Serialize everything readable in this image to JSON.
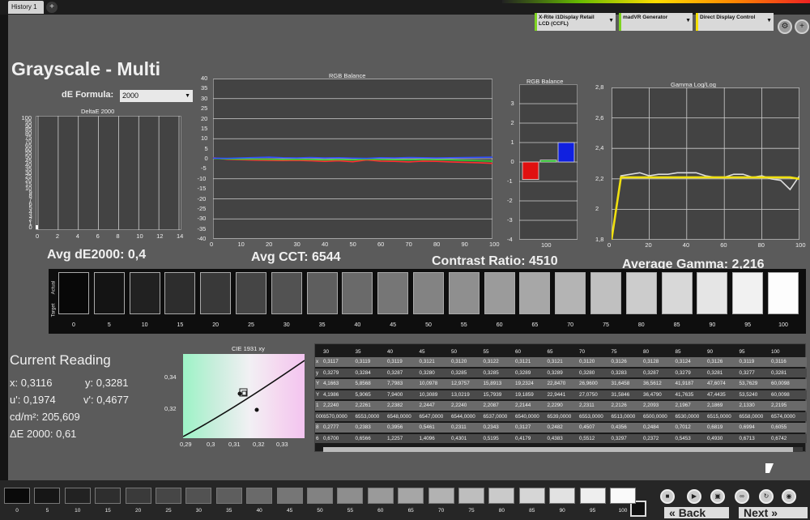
{
  "tabs": [
    {
      "label": "History 1"
    }
  ],
  "add_tab_icon": "plus-icon",
  "devices": {
    "meter": "X-Rite i1Display Retail LCD (CCFL)",
    "generator": "madVR Generator",
    "display": "Direct Display Control"
  },
  "page": {
    "title": "Grayscale - Multi",
    "formula_label": "dE Formula:",
    "formula_value": "2000"
  },
  "charts": {
    "delta_title": "DeltaE 2000",
    "rgb_title": "RGB Balance",
    "rgb_small_title": "RGB Balance",
    "gamma_title": "Gamma Log/Log"
  },
  "stats": {
    "avg_de": "Avg dE2000: 0,4",
    "avg_cct": "Avg CCT: 6544",
    "contrast": "Contrast Ratio: 4510",
    "avg_gamma": "Average Gamma: 2,216"
  },
  "band": {
    "actual_label": "Actual",
    "target_label": "Target"
  },
  "current_reading": {
    "title": "Current Reading",
    "x": "x: 0,3116",
    "y": "y: 0,3281",
    "u": "u': 0,1974",
    "v": "v': 0,4677",
    "cd": "cd/m²: 205,609",
    "de": "ΔE 2000: 0,61"
  },
  "cie": {
    "title": "CIE 1931 xy",
    "xticks": [
      "0,29",
      "0,3",
      "0,31",
      "0,32",
      "0,33"
    ],
    "yticks": [
      "0,34",
      "0,32"
    ]
  },
  "table": {
    "headers": [
      "30",
      "35",
      "40",
      "45",
      "50",
      "55",
      "60",
      "65",
      "70",
      "75",
      "80",
      "85",
      "90",
      "95",
      "100"
    ],
    "rows": [
      {
        "key": "x",
        "values": [
          "0,3117",
          "0,3119",
          "0,3119",
          "0,3121",
          "0,3120",
          "0,3122",
          "0,3121",
          "0,3121",
          "0,3120",
          "0,3126",
          "0,3128",
          "0,3124",
          "0,3126",
          "0,3119",
          "0,3116"
        ]
      },
      {
        "key": "y",
        "values": [
          "0,3279",
          "0,3284",
          "0,3287",
          "0,3280",
          "0,3285",
          "0,3285",
          "0,3289",
          "0,3289",
          "0,3280",
          "0,3283",
          "0,3287",
          "0,3279",
          "0,3281",
          "0,3277",
          "0,3281"
        ]
      },
      {
        "key": "Y",
        "values": [
          "4,1663",
          "5,8568",
          "7,7983",
          "10,0978",
          "12,9757",
          "15,8913",
          "19,2324",
          "22,8470",
          "26,9600",
          "31,6458",
          "36,5612",
          "41,9187",
          "47,6074",
          "53,7629",
          "60,0098"
        ]
      },
      {
        "key": "Y",
        "values": [
          "4,1986",
          "5,9065",
          "7,9400",
          "10,3089",
          "13,0219",
          "15,7939",
          "19,1859",
          "22,9441",
          "27,0750",
          "31,5846",
          "36,4790",
          "41,7635",
          "47,4435",
          "53,5240",
          "60,0098"
        ]
      },
      {
        "key": "1",
        "values": [
          "2,2240",
          "2,2261",
          "2,2382",
          "2,2447",
          "2,2240",
          "2,2087",
          "2,2144",
          "2,2290",
          "2,2311",
          "2,2126",
          "2,2093",
          "2,1967",
          "2,1869",
          "2,1330",
          "2,2195"
        ]
      },
      {
        "key": "0000",
        "values": [
          "6570,0000",
          "6553,0000",
          "6548,0000",
          "6547,0000",
          "6544,0000",
          "6537,0000",
          "6540,0000",
          "6539,0000",
          "6553,0000",
          "6513,0000",
          "6500,0000",
          "6530,0000",
          "6515,0000",
          "6558,0000",
          "6574,0000"
        ]
      },
      {
        "key": "8",
        "values": [
          "0,2777",
          "0,2383",
          "0,3956",
          "0,5461",
          "0,2311",
          "0,2343",
          "0,3127",
          "0,2482",
          "0,4507",
          "0,4356",
          "0,2484",
          "0,7012",
          "0,6819",
          "0,6994",
          "0,6055"
        ]
      },
      {
        "key": "6",
        "values": [
          "0,6700",
          "0,6566",
          "1,2257",
          "1,4096",
          "0,4301",
          "0,5195",
          "0,4179",
          "0,4383",
          "0,5512",
          "0,3297",
          "0,2372",
          "0,5453",
          "0,4930",
          "0,6713",
          "0,6742"
        ]
      }
    ]
  },
  "bottom": {
    "back": "Back",
    "next": "Next"
  },
  "colors": {
    "panel": "#5b5b5b",
    "plot": "#434343",
    "gamma_line": "#f0e010",
    "meter_bar": "#7ed321",
    "generator_bar": "#7ed321",
    "display_bar": "#f5e000"
  },
  "chart_data": [
    {
      "type": "bar",
      "title": "DeltaE 2000",
      "yticks": [
        0,
        1,
        2,
        3,
        4,
        5,
        6,
        7,
        8,
        9,
        10,
        15,
        20,
        25,
        30,
        35,
        40,
        45,
        50,
        55,
        60,
        65,
        70,
        75,
        80,
        85,
        90,
        95,
        100
      ],
      "xticks": [
        0,
        2,
        4,
        6,
        8,
        10,
        12,
        14
      ],
      "values": [
        0.3,
        0.3,
        0.3,
        0.4,
        0.2,
        0.2,
        0.3,
        0.2,
        0.5,
        0.4,
        0.2,
        0.7,
        0.7,
        0.7,
        0.6
      ]
    },
    {
      "type": "line",
      "title": "RGB Balance",
      "x": [
        0,
        5,
        10,
        15,
        20,
        25,
        30,
        35,
        40,
        45,
        50,
        55,
        60,
        65,
        70,
        75,
        80,
        85,
        90,
        95,
        100
      ],
      "xticks": [
        0,
        10,
        20,
        30,
        40,
        50,
        60,
        70,
        80,
        90,
        100
      ],
      "yticks": [
        40,
        35,
        30,
        25,
        20,
        15,
        10,
        5,
        0,
        -5,
        -10,
        -15,
        -20,
        -25,
        -30,
        -35,
        -40
      ],
      "ylim": [
        -40,
        40
      ],
      "series": [
        {
          "color": "#ff3030",
          "values": [
            0.5,
            -0.3,
            -0.5,
            -0.7,
            -0.8,
            -0.9,
            -0.8,
            -1.0,
            -1.3,
            -1.0,
            -1.5,
            -0.6,
            -1.2,
            -1.3,
            -1.6,
            -1.2,
            -1.3,
            -1.6,
            -1.8,
            -2.0,
            -2.3
          ]
        },
        {
          "color": "#30d030",
          "values": [
            0.2,
            -0.1,
            -0.2,
            -0.2,
            -0.3,
            -0.4,
            -0.3,
            -0.4,
            -0.6,
            -0.4,
            -0.6,
            -0.2,
            -0.4,
            -0.5,
            -0.6,
            -0.4,
            -0.5,
            -0.6,
            -0.8,
            -1.0,
            -1.2
          ]
        },
        {
          "color": "#3050ff",
          "values": [
            0.3,
            0.2,
            0.4,
            0.6,
            0.8,
            0.5,
            0.4,
            0.6,
            0.4,
            0.5,
            0.3,
            0.2,
            0.5,
            0.4,
            0.6,
            0.5,
            0.4,
            0.5,
            0.6,
            0.7,
            0.8
          ]
        }
      ]
    },
    {
      "type": "bar",
      "title": "RGB Balance",
      "categories": [
        "100"
      ],
      "yticks": [
        3,
        2,
        1,
        0,
        -1,
        -2,
        -3,
        -4
      ],
      "ylim": [
        -4,
        4
      ],
      "series": [
        {
          "color": "#e01010",
          "values": [
            -0.9
          ]
        },
        {
          "color": "#10c010",
          "values": [
            0.1
          ]
        },
        {
          "color": "#1020e0",
          "values": [
            1.0
          ]
        }
      ]
    },
    {
      "type": "line",
      "title": "Gamma Log/Log",
      "x": [
        0,
        5,
        10,
        15,
        20,
        25,
        30,
        35,
        40,
        45,
        50,
        55,
        60,
        65,
        70,
        75,
        80,
        85,
        90,
        95,
        100
      ],
      "xticks": [
        0,
        20,
        40,
        60,
        80,
        100
      ],
      "yticks": [
        "2,8",
        "2,6",
        "2,4",
        "2,2",
        "2",
        "1,8"
      ],
      "ylim": [
        1.8,
        2.8
      ],
      "series": [
        {
          "color": "#f0e010",
          "values": [
            1.8,
            2.21,
            2.21,
            2.21,
            2.21,
            2.21,
            2.21,
            2.21,
            2.21,
            2.21,
            2.21,
            2.21,
            2.21,
            2.21,
            2.21,
            2.21,
            2.21,
            2.21,
            2.21,
            2.21,
            2.2
          ]
        },
        {
          "color": "#dddddd",
          "values": [
            1.8,
            2.22,
            2.23,
            2.24,
            2.22,
            2.23,
            2.23,
            2.24,
            2.24,
            2.24,
            2.22,
            2.21,
            2.21,
            2.23,
            2.23,
            2.21,
            2.22,
            2.2,
            2.19,
            2.13,
            2.22
          ]
        }
      ]
    }
  ],
  "band_levels": [
    "0",
    "5",
    "10",
    "15",
    "20",
    "25",
    "30",
    "35",
    "40",
    "45",
    "50",
    "55",
    "60",
    "65",
    "70",
    "75",
    "80",
    "85",
    "90",
    "95",
    "100"
  ],
  "bottom_levels": [
    "0",
    "5",
    "10",
    "15",
    "20",
    "25",
    "30",
    "35",
    "40",
    "45",
    "50",
    "55",
    "60",
    "65",
    "70",
    "75",
    "80",
    "85",
    "90",
    "95",
    "100"
  ]
}
